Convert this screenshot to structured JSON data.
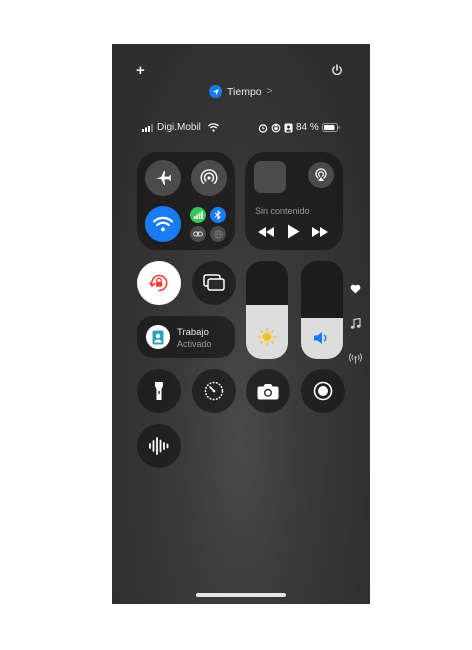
{
  "top_bar": {
    "add_label": "+",
    "power_icon": "power-icon"
  },
  "location": {
    "label": "Tiempo",
    "chevron": ">"
  },
  "status": {
    "carrier": "Digi.Mobil",
    "battery_text": "84 %",
    "battery_level": 84
  },
  "connectivity": {
    "airplane": "airplane-icon",
    "airdrop": "airdrop-icon",
    "wifi": "wifi-icon",
    "cellular": "cellular-icon",
    "bluetooth": "bluetooth-icon"
  },
  "media": {
    "now_playing": "Sin contenido"
  },
  "focus": {
    "title": "Trabajo",
    "subtitle": "Activado"
  },
  "sliders": {
    "brightness": 0.55,
    "volume": 0.42
  },
  "colors": {
    "accent_blue": "#1a7cf5",
    "green": "#34c759",
    "lock_red": "#ff3b30"
  }
}
